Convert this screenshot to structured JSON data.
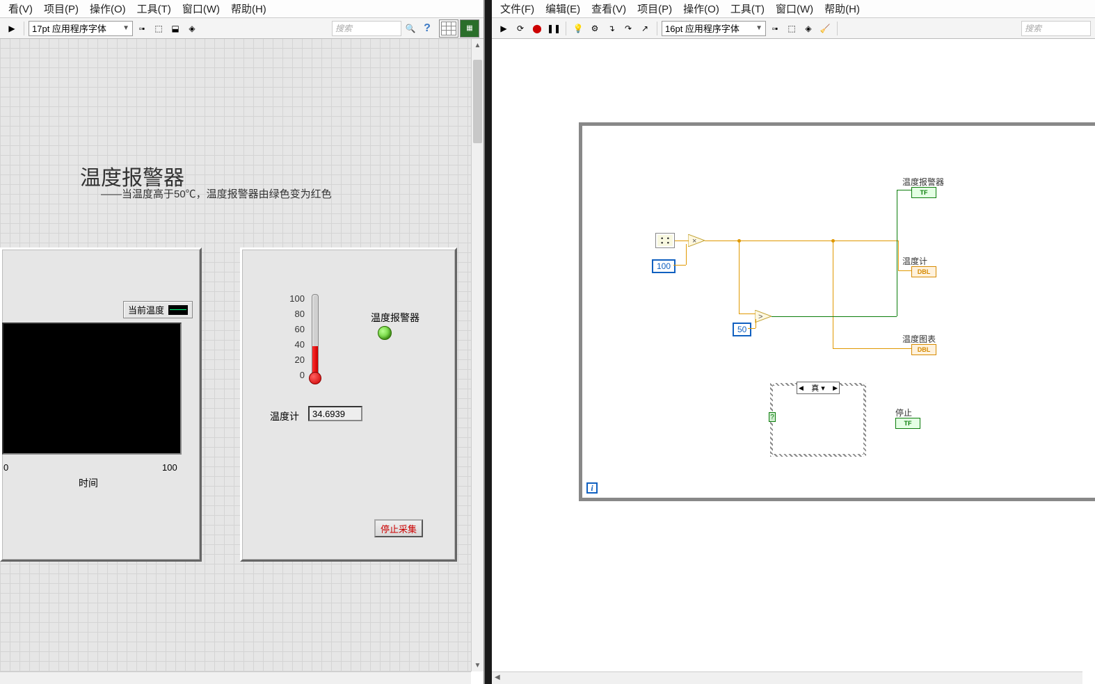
{
  "left_menu": [
    "看(V)",
    "项目(P)",
    "操作(O)",
    "工具(T)",
    "窗口(W)",
    "帮助(H)"
  ],
  "right_menu": [
    "文件(F)",
    "编辑(E)",
    "查看(V)",
    "项目(P)",
    "操作(O)",
    "工具(T)",
    "窗口(W)",
    "帮助(H)"
  ],
  "left_font": "17pt 应用程序字体",
  "right_font": "16pt 应用程序字体",
  "search_ph": "搜索",
  "fp": {
    "title": "温度报警器",
    "subtitle": "——当温度高于50℃，温度报警器由绿色变为红色",
    "legend": "当前温度",
    "xlabel": "时间",
    "x0": "0",
    "x1": "100",
    "therm_scale": [
      "100",
      "80",
      "60",
      "40",
      "20",
      "0"
    ],
    "therm_fill_pct": 35,
    "led_label": "温度报警器",
    "num_label": "温度计",
    "num_value": "34.6939",
    "stop": "停止采集"
  },
  "bd": {
    "const100": "100",
    "const50": "50",
    "case_value": "真",
    "ind_alarm": "温度报警器",
    "ind_therm": "温度计",
    "ind_chart": "温度图表",
    "ind_stop": "停止",
    "tf": "TF",
    "dbl": "DBL"
  }
}
